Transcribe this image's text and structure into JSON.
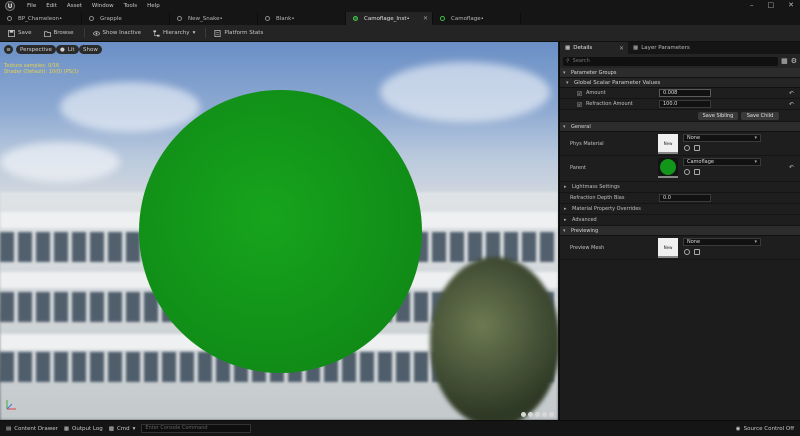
{
  "menu": [
    "File",
    "Edit",
    "Asset",
    "Window",
    "Tools",
    "Help"
  ],
  "tabs": [
    {
      "label": "BP_Chameleon•",
      "active": false
    },
    {
      "label": "Grapple",
      "active": false
    },
    {
      "label": "New_Snake•",
      "active": false
    },
    {
      "label": "Blank•",
      "active": false
    },
    {
      "label": "Camoflage_Inst•",
      "active": true
    },
    {
      "label": "Camoflage•",
      "active": false
    }
  ],
  "toolbar": {
    "save": "Save",
    "browse": "Browse",
    "show_inactive": "Show Inactive",
    "hierarchy": "Hierarchy",
    "platform_stats": "Platform Stats"
  },
  "viewport": {
    "perspective": "Perspective",
    "lit": "Lit",
    "show": "Show",
    "stats_line1": "Texture samples: 0/16",
    "stats_line2": "Shader (Default): 10(0) (PS/1)"
  },
  "panel": {
    "details_tab": "Details",
    "layer_tab": "Layer Parameters",
    "search_placeholder": "Search",
    "parameter_groups": "Parameter Groups",
    "global_scalar": "Global Scalar Parameter Values",
    "amount_label": "Amount",
    "amount_value": "0.008",
    "refraction_label": "Refraction Amount",
    "refraction_value": "100.0",
    "save_sibling": "Save Sibling",
    "save_child": "Save Child",
    "general": "General",
    "phys_material": "Phys Material",
    "phys_value": "None",
    "thumb_new": "New",
    "parent": "Parent",
    "parent_value": "Camoflage",
    "lightmass": "Lightmass Settings",
    "refraction_depth": "Refraction Depth Bias",
    "refraction_depth_value": "0.0",
    "material_overrides": "Material Property Overrides",
    "advanced": "Advanced",
    "previewing": "Previewing",
    "preview_mesh": "Preview Mesh",
    "preview_value": "None"
  },
  "statusbar": {
    "content_drawer": "Content Drawer",
    "output_log": "Output Log",
    "cmd": "Cmd",
    "console_placeholder": "Enter Console Command",
    "source_control": "Source Control Off"
  },
  "colors": {
    "sphere": "#11961a",
    "accent": "#45c04a"
  }
}
